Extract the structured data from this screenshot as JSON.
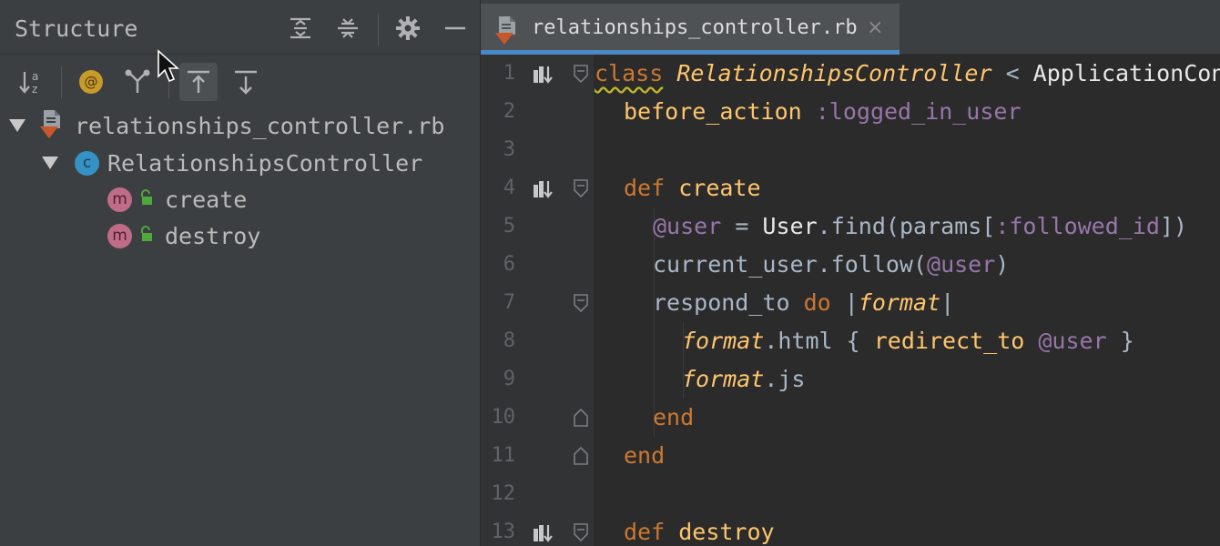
{
  "structure": {
    "title": "Structure",
    "header_buttons": [
      "expand-all-icon",
      "collapse-all-icon",
      "gear-icon",
      "minimize-icon"
    ],
    "toolbar_buttons": [
      "sort-alphabetically-icon",
      "show-fields-icon",
      "show-inherited-icon",
      "autoscroll-to-source-icon",
      "autoscroll-from-source-icon"
    ],
    "tree": {
      "file": "relationships_controller.rb",
      "class_name": "RelationshipsController",
      "class_badge": "c",
      "methods": [
        {
          "name": "create",
          "badge": "m"
        },
        {
          "name": "destroy",
          "badge": "m"
        }
      ]
    }
  },
  "editor": {
    "tab_label": "relationships_controller.rb",
    "tab_close": "×",
    "line_numbers": [
      "1",
      "2",
      "3",
      "4",
      "5",
      "6",
      "7",
      "8",
      "9",
      "10",
      "11",
      "12",
      "13"
    ],
    "code": {
      "l1": [
        "class",
        " ",
        "RelationshipsController",
        " < ",
        "ApplicationController"
      ],
      "l2": [
        "before_action",
        " ",
        ":logged_in_user"
      ],
      "l4": [
        "def",
        " ",
        "create"
      ],
      "l5": [
        "@user",
        " = ",
        "User",
        ".find(params[",
        ":followed_id",
        "])"
      ],
      "l6": [
        "current_user.follow(",
        "@user",
        ")"
      ],
      "l7": [
        "respond_to ",
        "do",
        " |",
        "format",
        "|"
      ],
      "l8": [
        "format",
        ".html { ",
        "redirect_to",
        " ",
        "@user",
        " }"
      ],
      "l9": [
        "format",
        ".js"
      ],
      "l10": [
        "end"
      ],
      "l11": [
        "end"
      ],
      "l13": [
        "def",
        " ",
        "destroy"
      ]
    }
  },
  "colors": {
    "panel_bg": "#3c3f41",
    "editor_bg": "#2b2b2b",
    "keyword": "#cc7832",
    "function": "#ffc66d",
    "symbol": "#9876aa",
    "tab_underline": "#4a88c7"
  }
}
